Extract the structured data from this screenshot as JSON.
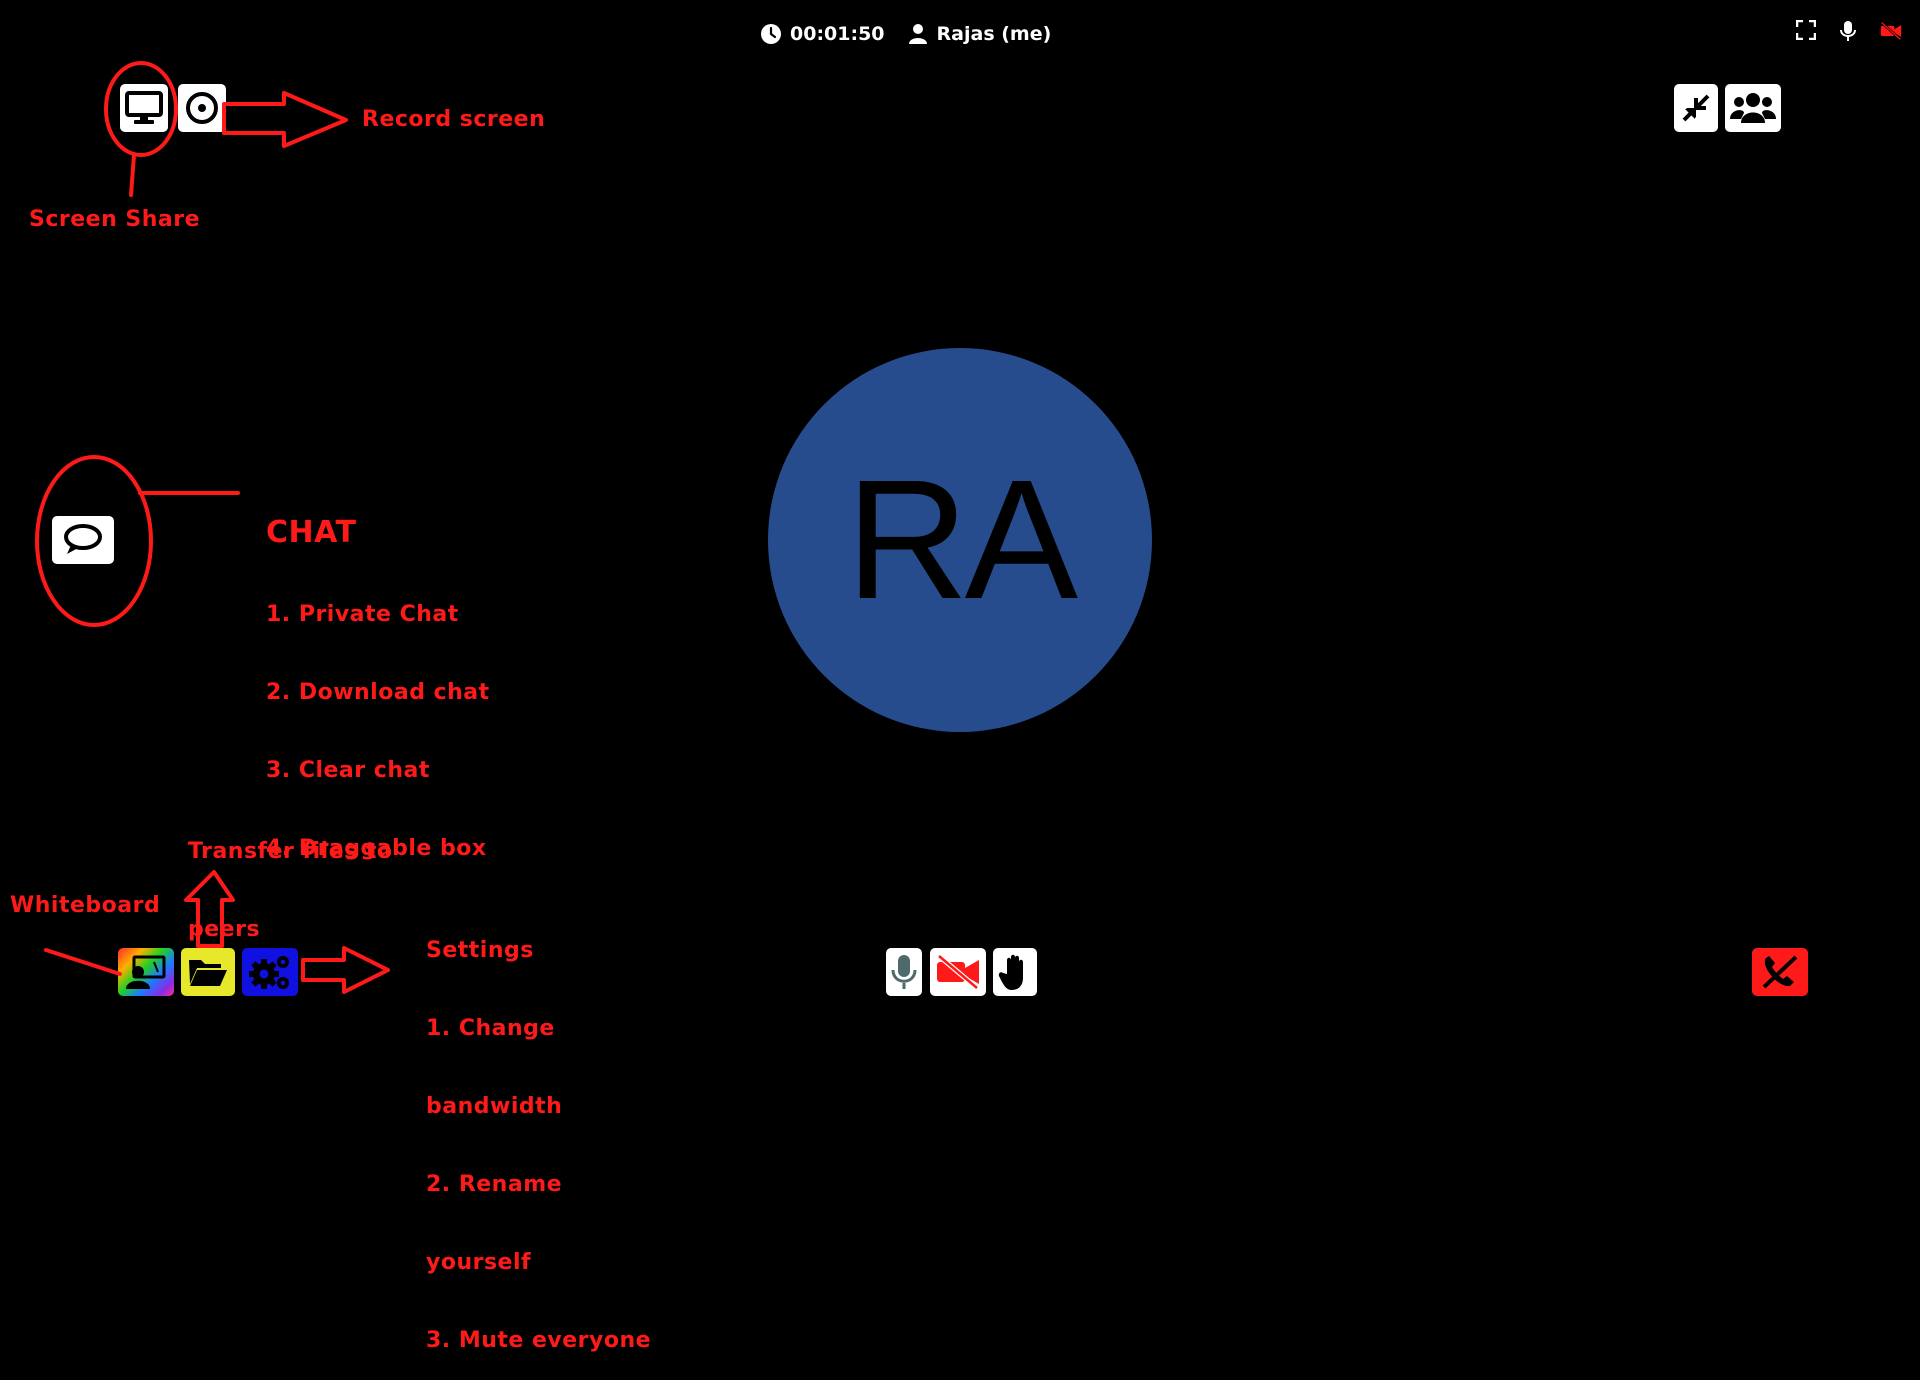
{
  "status_bar": {
    "timer": "00:01:50",
    "user_name": "Rajas (me)"
  },
  "avatar": {
    "initials": "RA",
    "color": "#264c8d"
  },
  "icons": {
    "top_left": [
      "monitor-icon",
      "record-icon"
    ],
    "top_right": [
      "fullscreen-icon",
      "microphone-icon",
      "video-off-icon"
    ],
    "top_right_buttons": [
      "minimize-icon",
      "participants-icon"
    ],
    "left": [
      "chat-icon"
    ],
    "bottom_left": [
      "whiteboard-icon",
      "folder-open-icon",
      "settings-icon"
    ],
    "bottom_center": [
      "microphone-icon",
      "video-off-icon",
      "raise-hand-icon"
    ],
    "bottom_right": [
      "end-call-icon"
    ]
  },
  "annotations": {
    "record_screen": "Record screen",
    "screen_share": "Screen Share",
    "chat": {
      "title": "CHAT",
      "items": [
        "1. Private Chat",
        "2. Download chat",
        "3. Clear chat",
        "4. Draggable box"
      ]
    },
    "transfer_files": [
      "Transfer files to",
      "peers"
    ],
    "whiteboard": "Whiteboard",
    "settings": {
      "title": "Settings",
      "lines": [
        "1. Change",
        "bandwidth",
        "2. Rename",
        "yourself",
        "3. Mute everyone"
      ]
    }
  },
  "colors": {
    "annotation": "#ff1a1a",
    "end_call": "#ff1a1a",
    "files_button": "#e8e82a",
    "settings_button": "#1010e0"
  }
}
